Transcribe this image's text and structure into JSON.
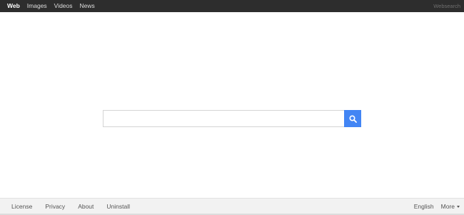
{
  "topbar": {
    "nav": [
      {
        "label": "Web",
        "active": true
      },
      {
        "label": "Images",
        "active": false
      },
      {
        "label": "Videos",
        "active": false
      },
      {
        "label": "News",
        "active": false
      }
    ],
    "brand": "Websearch"
  },
  "search": {
    "value": "",
    "placeholder": "",
    "button_icon": "search-icon",
    "button_color": "#4285f4"
  },
  "footer": {
    "links": [
      "License",
      "Privacy",
      "About",
      "Uninstall"
    ],
    "language": "English",
    "more_label": "More",
    "more_icon": "caret-down-icon"
  },
  "colors": {
    "topbar_bg": "#2d2d2d",
    "footer_bg": "#f2f2f2",
    "accent": "#4285f4"
  }
}
